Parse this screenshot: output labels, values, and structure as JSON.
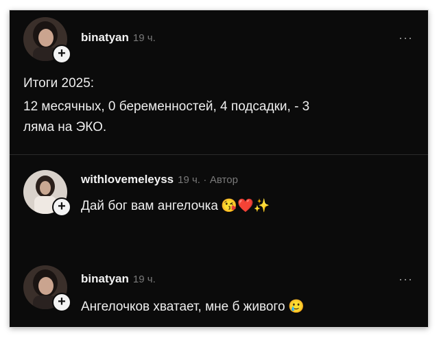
{
  "posts": [
    {
      "username": "binatyan",
      "time": "19 ч.",
      "lines": [
        "Итоги 2025:",
        "12 месячных, 0 беременностей, 4 подсадки, - 3",
        "ляма на ЭКО."
      ]
    },
    {
      "username": "withlovemeleyss",
      "time": "19 ч.",
      "author_sep": "·",
      "author": "Автор",
      "text": "Дай бог вам ангелочка",
      "emoji": "😘❤️✨"
    },
    {
      "username": "binatyan",
      "time": "19 ч.",
      "text": "Ангелочков хватает, мне б живого",
      "emoji": "🥲"
    }
  ],
  "more_icon": "···",
  "plus_icon": "+"
}
